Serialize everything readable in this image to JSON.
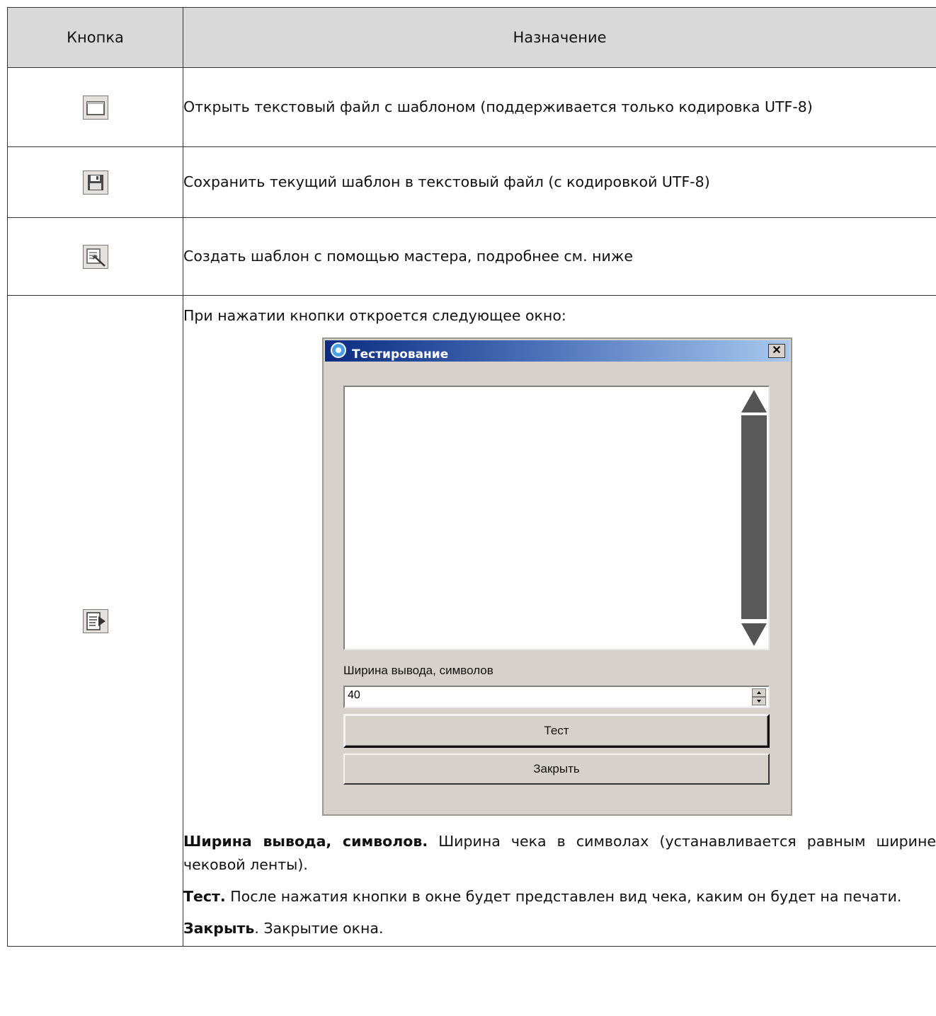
{
  "table": {
    "headers": [
      "Кнопка",
      "Назначение"
    ],
    "rows": [
      {
        "icon": "open-folder-icon",
        "text": "Открыть текстовый файл с шаблоном (поддерживается только кодировка UTF-8)"
      },
      {
        "icon": "save-disk-icon",
        "text": "Сохранить текущий шаблон в текстовый файл (с кодировкой UTF-8)"
      },
      {
        "icon": "wizard-icon",
        "text": "Создать шаблон с помощью мастера, подробнее см. ниже"
      },
      {
        "icon": "test-run-icon",
        "intro": "При нажатии кнопки откроется следующее окно:",
        "dialog": {
          "title": "Тестирование",
          "close_glyph": "✕",
          "width_label": "Ширина вывода, символов",
          "width_value": "40",
          "test_button": "Тест",
          "close_button": "Закрыть"
        },
        "notes": [
          {
            "term": "Ширина вывода, символов.",
            "text": " Ширина чека в символах (устанавливается равным ширине чековой ленты)."
          },
          {
            "term": "Тест.",
            "text": " После нажатия кнопки в окне будет представлен вид чека, каким он будет на печати."
          },
          {
            "term": "Закрыть",
            "text": ". Закрытие окна."
          }
        ]
      }
    ]
  }
}
